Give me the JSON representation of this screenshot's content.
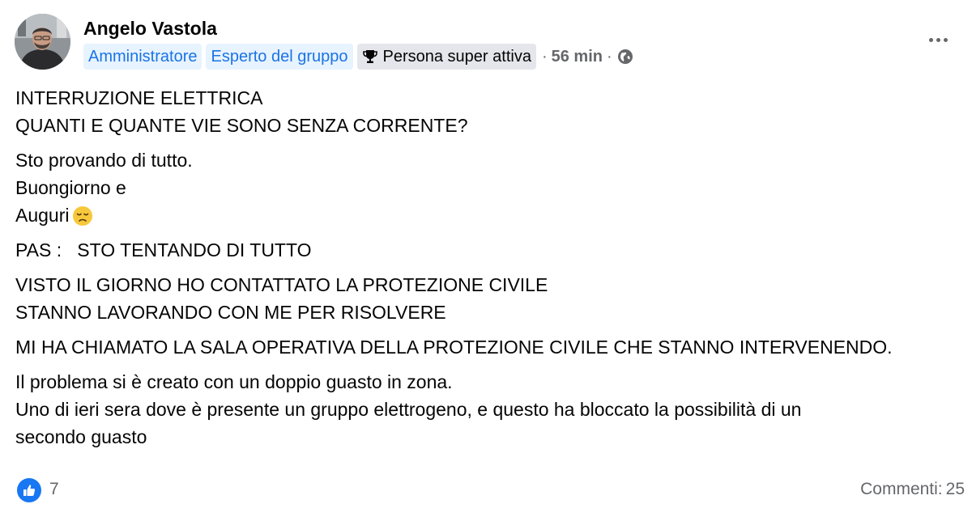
{
  "author": {
    "name": "Angelo Vastola",
    "badges": [
      "Amministratore",
      "Esperto del gruppo",
      "Persona super attiva"
    ],
    "time": "56 min",
    "separator": "·",
    "privacy_icon": "globe-icon",
    "badge_icon": "trophy-icon"
  },
  "post": {
    "paragraphs": [
      [
        "INTERRUZIONE ELETTRICA",
        "QUANTI E QUANTE VIE SONO SENZA CORRENTE?"
      ],
      [
        "Sto provando di tutto.",
        "Buongiorno e",
        "Auguri"
      ],
      [
        "PAS :   STO TENTANDO DI TUTTO"
      ],
      [
        "VISTO IL GIORNO HO CONTATTATO LA PROTEZIONE CIVILE",
        "STANNO LAVORANDO CON ME PER RISOLVERE"
      ],
      [
        "MI HA CHIAMATO LA SALA OPERATIVA DELLA PROTEZIONE CIVILE CHE STANNO INTERVENENDO."
      ],
      [
        "Il problema si è creato con un doppio guasto in zona.",
        "Uno di ieri sera dove è presente un gruppo elettrogeno, e questo ha bloccato la possibilità di un",
        "secondo guasto"
      ]
    ],
    "emoji": "disappointed-face-emoji"
  },
  "footer": {
    "reaction_icon": "like-icon",
    "like_count": "7",
    "comments_label": "Commenti:",
    "comments_count": "25"
  },
  "colors": {
    "accent": "#1877f2",
    "badge_blue_bg": "#e7f3ff",
    "badge_blue_text": "#1b74e4",
    "badge_gray_bg": "#e4e6eb",
    "muted_text": "#65676b"
  }
}
